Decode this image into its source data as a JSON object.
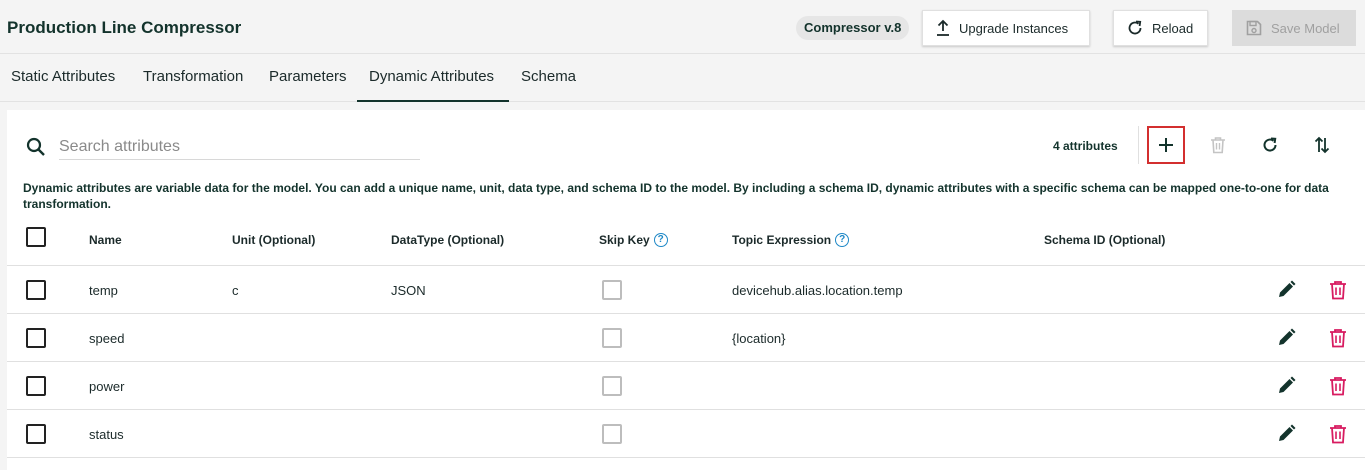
{
  "header": {
    "title": "Production Line Compressor",
    "version_badge": "Compressor v.8",
    "upgrade_label": "Upgrade Instances",
    "reload_label": "Reload",
    "save_label": "Save Model"
  },
  "tabs": [
    {
      "label": "Static Attributes",
      "active": false
    },
    {
      "label": "Transformation",
      "active": false
    },
    {
      "label": "Parameters",
      "active": false
    },
    {
      "label": "Dynamic Attributes",
      "active": true
    },
    {
      "label": "Schema",
      "active": false
    }
  ],
  "toolbar": {
    "search_placeholder": "Search attributes",
    "attr_count": "4 attributes"
  },
  "description": "Dynamic attributes are variable data for the model. You can add a unique name, unit, data type, and schema ID to the model. By including a schema ID, dynamic attributes with a specific schema can be mapped one-to-one for data transformation.",
  "table": {
    "columns": [
      "Name",
      "Unit (Optional)",
      "DataType (Optional)",
      "Skip Key",
      "Topic Expression",
      "Schema ID (Optional)"
    ],
    "rows": [
      {
        "name": "temp",
        "unit": "c",
        "datatype": "JSON",
        "topic": "devicehub.alias.location.temp",
        "schema": ""
      },
      {
        "name": "speed",
        "unit": "",
        "datatype": "",
        "topic": "{location}",
        "schema": ""
      },
      {
        "name": "power",
        "unit": "",
        "datatype": "",
        "topic": "",
        "schema": ""
      },
      {
        "name": "status",
        "unit": "",
        "datatype": "",
        "topic": "",
        "schema": ""
      }
    ]
  },
  "colors": {
    "primary": "#13332c",
    "delete": "#d81b60",
    "highlight": "#d32f2f",
    "help": "#1e88c7"
  },
  "icons": {
    "upgrade": "upload-icon",
    "reload": "reload-icon",
    "save": "floppy-disk-icon",
    "search": "search-icon",
    "add": "plus-icon",
    "delete": "trash-icon",
    "refresh": "refresh-icon",
    "sort": "sort-arrows-icon",
    "edit": "pencil-icon",
    "help": "help-circle-icon"
  }
}
